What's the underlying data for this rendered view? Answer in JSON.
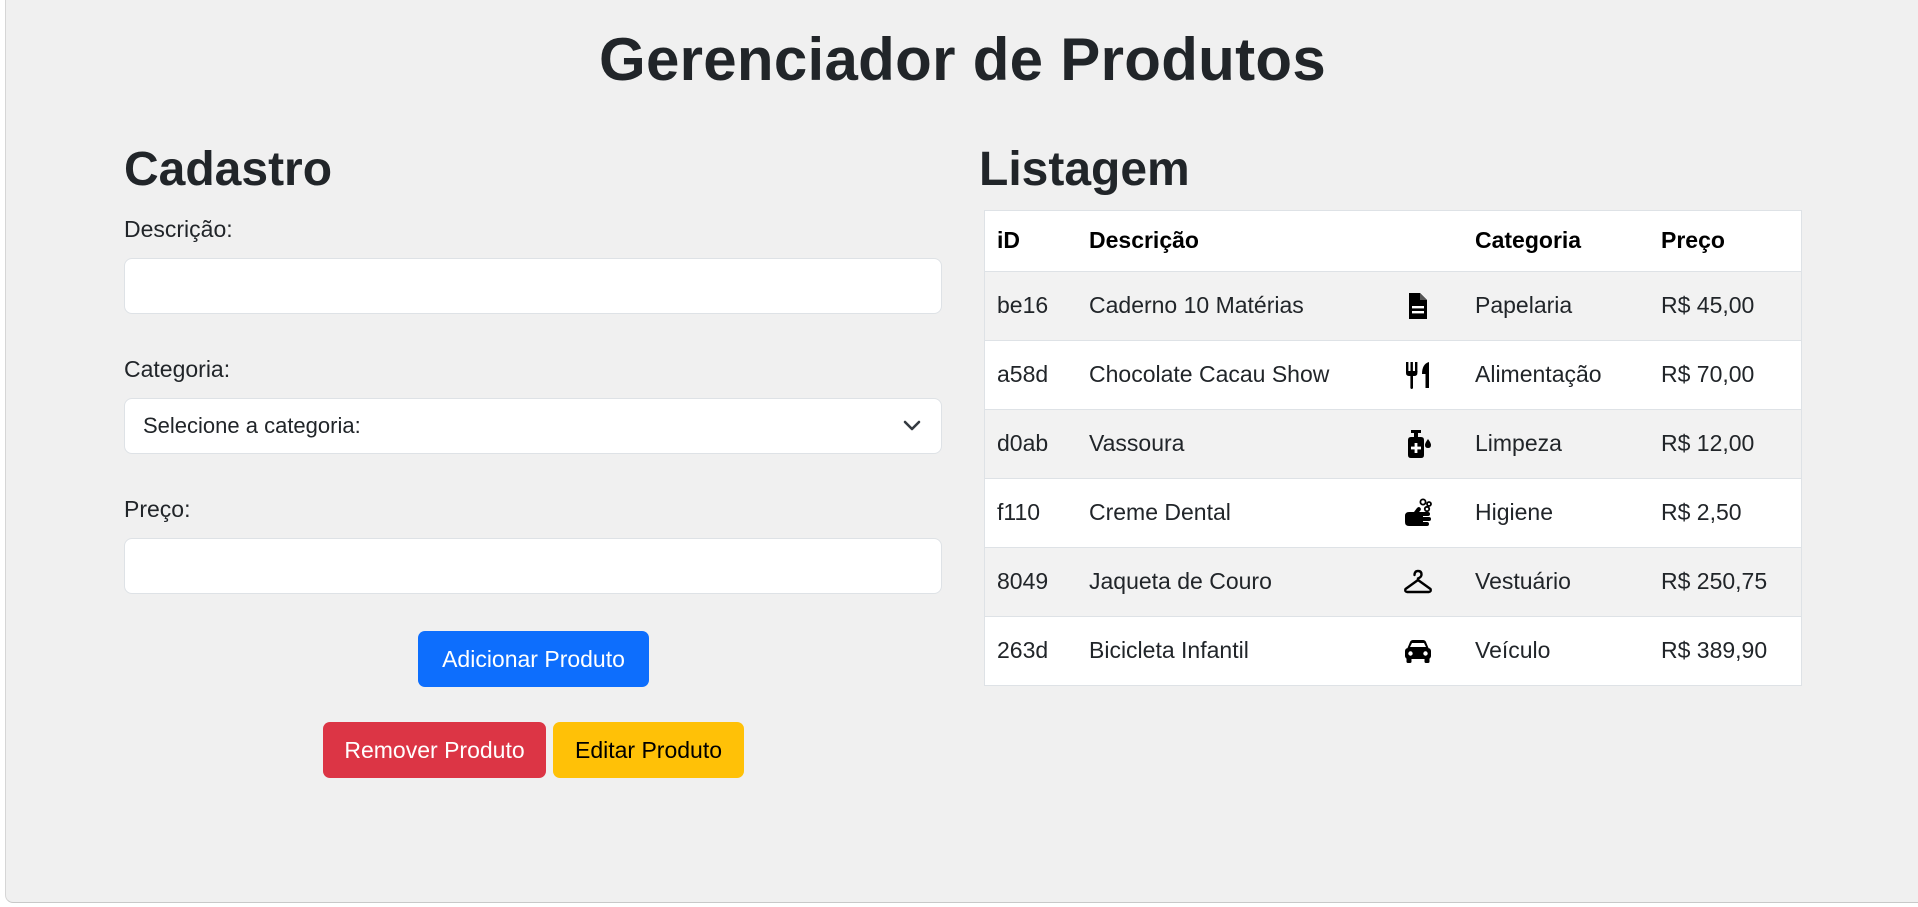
{
  "page_title": "Gerenciador de Produtos",
  "form": {
    "title": "Cadastro",
    "description_label": "Descrição:",
    "description_value": "",
    "category_label": "Categoria:",
    "category_selected": "Selecione a categoria:",
    "price_label": "Preço:",
    "price_value": "",
    "add_label": "Adicionar Produto",
    "remove_label": "Remover Produto",
    "edit_label": "Editar Produto"
  },
  "listing": {
    "title": "Listagem",
    "headers": [
      "iD",
      "Descrição",
      "",
      "Categoria",
      "Preço"
    ],
    "rows": [
      {
        "id": "be16",
        "description": "Caderno 10 Matérias",
        "icon": "file-icon",
        "category": "Papelaria",
        "price": "R$ 45,00"
      },
      {
        "id": "a58d",
        "description": "Chocolate Cacau Show",
        "icon": "utensils-icon",
        "category": "Alimentação",
        "price": "R$ 70,00"
      },
      {
        "id": "d0ab",
        "description": "Vassoura",
        "icon": "pump-soap-icon",
        "category": "Limpeza",
        "price": "R$ 12,00"
      },
      {
        "id": "f110",
        "description": "Creme Dental",
        "icon": "hand-soap-icon",
        "category": "Higiene",
        "price": "R$ 2,50"
      },
      {
        "id": "8049",
        "description": "Jaqueta de Couro",
        "icon": "hanger-icon",
        "category": "Vestuário",
        "price": "R$ 250,75"
      },
      {
        "id": "263d",
        "description": "Bicicleta Infantil",
        "icon": "car-icon",
        "category": "Veículo",
        "price": "R$ 389,90"
      }
    ]
  },
  "colors": {
    "primary": "#0d6efd",
    "danger": "#dc3545",
    "warning": "#ffc107",
    "background": "#f0f0f0"
  }
}
